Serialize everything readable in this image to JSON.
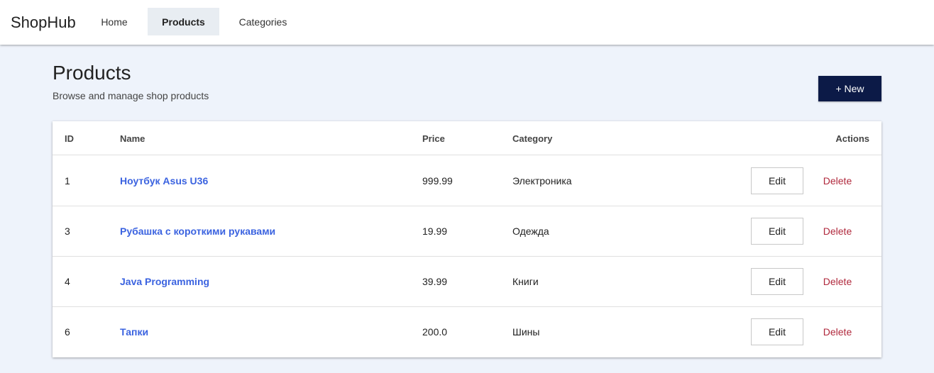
{
  "nav": {
    "brand": "ShopHub",
    "links": [
      {
        "label": "Home"
      },
      {
        "label": "Products",
        "active": true
      },
      {
        "label": "Categories"
      }
    ]
  },
  "page": {
    "title": "Products",
    "subtitle": "Browse and manage shop products",
    "new_label": "+ New"
  },
  "table": {
    "headers": {
      "id": "ID",
      "name": "Name",
      "price": "Price",
      "category": "Category",
      "actions": "Actions"
    },
    "rows": [
      {
        "id": "1",
        "name": "Ноутбук Asus U36",
        "price": "999.99",
        "category": "Электроника"
      },
      {
        "id": "3",
        "name": "Рубашка с короткими рукавами",
        "price": "19.99",
        "category": "Одежда"
      },
      {
        "id": "4",
        "name": "Java Programming",
        "price": "39.99",
        "category": "Книги"
      },
      {
        "id": "6",
        "name": "Тапки",
        "price": "200.0",
        "category": "Шины"
      }
    ],
    "edit_label": "Edit",
    "delete_label": "Delete"
  },
  "colors": {
    "accent": "#0c1a47",
    "link": "#3b63e0",
    "danger": "#b0283c",
    "background": "#eef3fb"
  }
}
